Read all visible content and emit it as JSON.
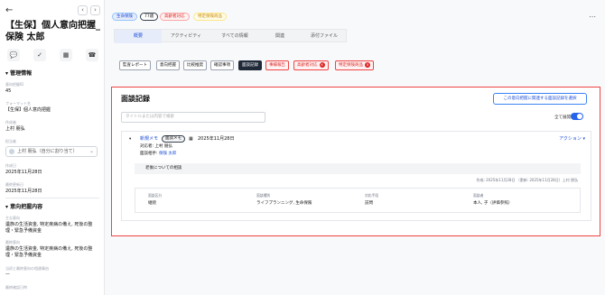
{
  "left": {
    "back_icon": "←",
    "prev_icon": "‹",
    "next_icon": "›",
    "title": "【生保】個人意向把握_保険 太郎",
    "action_icons": [
      "💬",
      "✓",
      "▦",
      "☎"
    ],
    "section1": "▾ 管理情報",
    "fields": [
      {
        "label": "意向把握ID",
        "value": "45"
      },
      {
        "label": "フォーマット名",
        "value": "【生保】個人意向把握"
      },
      {
        "label": "作成者",
        "value": "上村 朋弘"
      },
      {
        "label": "担当者",
        "value": "上村 朋弘（自分に割り当て）"
      },
      {
        "label": "作成日",
        "value": "2025年11月28日"
      },
      {
        "label": "最終更新日",
        "value": "2025年11月28日"
      }
    ],
    "section2": "▾ 意向把握内容",
    "fields2": [
      {
        "label": "主な意向",
        "value": "遺族の生活資金, 特定疾病の備え, 死後の整理・緊急予備資金"
      },
      {
        "label": "最終意向",
        "value": "遺族の生活資金, 特定疾病の備え, 死後の整理・緊急予備資金"
      },
      {
        "label": "当初と最終意向の相違事由",
        "value": "ー"
      },
      {
        "label": "最終確認日時",
        "value": ""
      }
    ]
  },
  "main": {
    "tags": [
      {
        "label": "生命保険",
        "color": "#1d4ed8",
        "bg": "#e6ecfa"
      },
      {
        "label": "77歳",
        "color": "#111",
        "bg": "#fff"
      },
      {
        "label": "高齢者対応",
        "color": "#dc2626",
        "bg": "#fef2f2"
      },
      {
        "label": "特定保険商品",
        "color": "#ca8a04",
        "bg": "#fefce8"
      }
    ],
    "more_icon": "⋯",
    "tabs": [
      "概要",
      "アクティビティ",
      "すべての情報",
      "関連",
      "添付ファイル"
    ],
    "categories": [
      {
        "label": "監査レポート",
        "style": ""
      },
      {
        "label": "意向把握",
        "style": ""
      },
      {
        "label": "比較推奨",
        "style": ""
      },
      {
        "label": "確認事項",
        "style": ""
      },
      {
        "label": "面談記録",
        "style": "sel"
      },
      {
        "label": "事績報告",
        "style": "red"
      },
      {
        "label": "高齢者対応",
        "style": "red",
        "x": true
      },
      {
        "label": "特定保険商品",
        "style": "red",
        "x": true
      }
    ],
    "panel": {
      "title": "面談記録",
      "button": "この意向把握に関連する面談記録を選択",
      "search_placeholder": "タイトルまたは内容で検索",
      "expand_label": "全て展開",
      "card": {
        "caret": "▾",
        "name": "新規メモ",
        "chip": "面談メモ",
        "cal_icon": "▦",
        "date": "2025年11月28日",
        "action": "アクション ▾",
        "line1": "対応者: 上村 朋弘",
        "line2_prefix": "面談相手: ",
        "line2_link": "保険 太郎",
        "note": "老後についての相談",
        "created": "作成: 2025年11月28日 （更新: 2025年11月28日）上村 朋弘",
        "details": [
          {
            "label": "面談区分",
            "value": "継続"
          },
          {
            "label": "面談種別",
            "value": "ライフプランニング, 生命保険"
          },
          {
            "label": "対応手段",
            "value": "訪問"
          },
          {
            "label": "面談者",
            "value": "本人, 子（評価参照）"
          }
        ]
      }
    }
  }
}
